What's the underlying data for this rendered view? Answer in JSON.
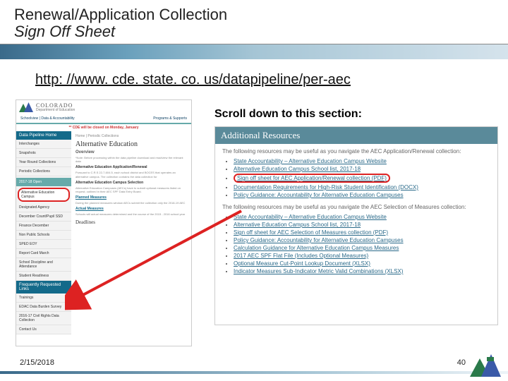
{
  "header": {
    "title_main": "Renewal/Application Collection",
    "title_sub": "Sign Off Sheet"
  },
  "url": "http: //www. cde. state. co. us/datapipeline/per-aec",
  "scroll_label": "Scroll down to this section:",
  "left_shot": {
    "brand": "COLORADO",
    "brand_sub": "Department of Education",
    "nav_left": "Schoolview | Data & Accountability",
    "nav_right": "Programs & Supports",
    "alert": "** CDE will be closed on Monday, January",
    "side_header": "Data Pipeline Home",
    "side_items": [
      "Interchanges",
      "Snapshots",
      "Year Round Collections",
      "Periodic Collections"
    ],
    "side_sub_header": "2017-18 Open",
    "side_highlight": "Alternative Education Campus",
    "side_items2": [
      "Designated Agency",
      "December Count/Pupil SSD",
      "Finance December",
      "Non Public Schools",
      "SPED EOY",
      "Report Card March",
      "School Discipline and Attendance",
      "Student Readiness"
    ],
    "side_header2": "Frequently Requested Links",
    "side_items3": [
      "Trainings",
      "EDAC Data Burden Survey",
      "2016-17 Civil Rights Data Collection",
      "Contact Us"
    ],
    "crumb": "Home  |  Periodic Collections",
    "page_title": "Alternative Education",
    "overview": "Overview",
    "para1": "*Note: Before processing within the data pipeline download and read/view the relevant data",
    "sub1": "Alternative Education Application/Renewal",
    "para2": "Pursuant to C.R.S 22-7-604.5, each school district and BOCES that operates an alternative campus. The collection contains the data collection for",
    "sub2": "Alternative Education Campus Selection",
    "para3": "Alternative Education Campuses (AECs) have to submit optional measures listed on request; outlined in their AEC SPF Data Entry Board.",
    "sub3": "Planned Measures",
    "para4": "During the planned measures window AECs submit the collection only the 2018-19 AEC",
    "sub4": "Actual Measures",
    "para5": "Schools will actual measures determined and the course of the 2015 - 2016 school year",
    "deadlines": "Deadlines"
  },
  "resources": {
    "heading": "Additional Resources",
    "intro1": "The following resources may be useful as you navigate the AEC Application/Renewal collection:",
    "list1": [
      "State Accountability – Alternative Education Campus Website",
      "Alternative Education Campus School list, 2017-18",
      "Sign off sheet for AEC Application/Renewal collection (PDF)",
      "Documentation Requirements for High-Risk Student Identification (DOCX)",
      "Policy Guidance: Accountability for Alternative Education Campuses"
    ],
    "intro2": "The following resources may be useful as you navigate the AEC Selection of Measures collection:",
    "list2": [
      "State Accountability – Alternative Education Campus Website",
      "Alternative Education Campus School list, 2017-18",
      "Sign off sheet for AEC Selection of Measures collection (PDF)",
      "Policy Guidance: Accountability for Alternative Education Campuses",
      "Calculation Guidance for Alternative Education Campus Measures",
      "2017 AEC SPF Flat File (Includes Optional Measures)",
      "Optional Measure Cut-Point Lookup Document (XLSX)",
      "Indicator Measures Sub-Indicator Metric Valid Combinations (XLSX)"
    ]
  },
  "footer": {
    "date": "2/15/2018",
    "page": "40"
  }
}
